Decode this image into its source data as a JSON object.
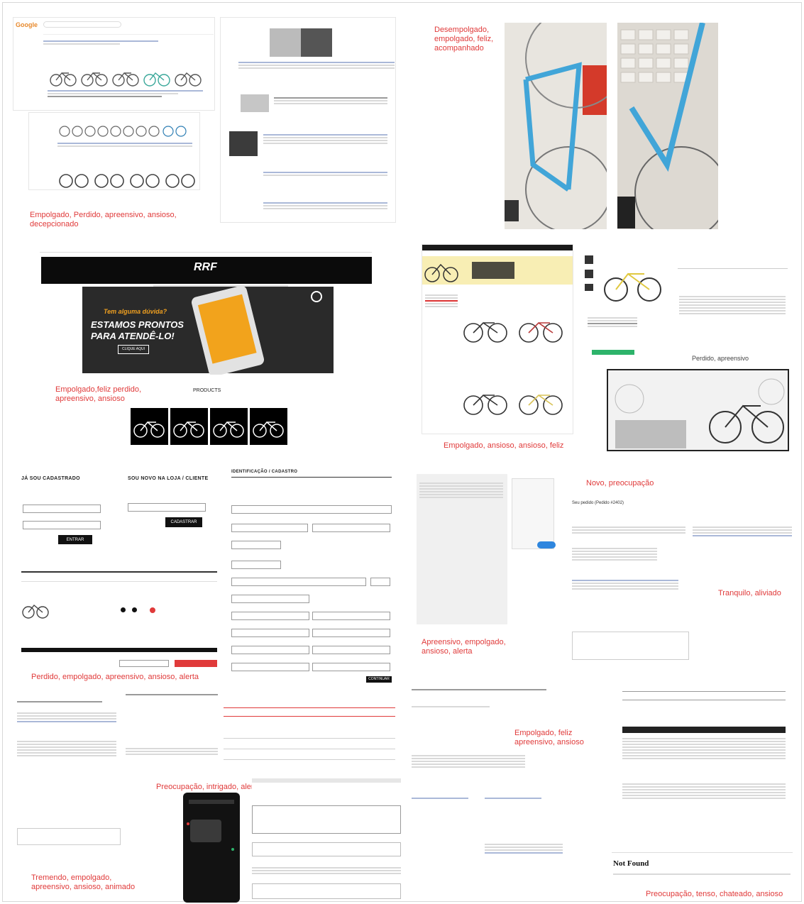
{
  "captions": {
    "c1": "Empolgado, Perdido, apreensivo, ansioso, decepcionado",
    "c2": "Desempolgado,\nempolgado, feliz,\nacompanhado",
    "c3": "Empolgado,feliz perdido,\napreensivo, ansioso",
    "c4": "Empolgado, ansioso, ansioso, feliz",
    "c5": "Perdido, apreensivo",
    "c6": "Perdido, empolgado, apreensivo, ansioso, alerta",
    "c7": "Apreensivo, empolgado,\nansioso, alerta",
    "c8": "Novo, preocupação",
    "c9": "Tranquilo, aliviado",
    "c10": "Preocupação, intrigado, alerta",
    "c11": "Empolgado, feliz\napreensivo, ansioso",
    "c12": "Preocupação, tenso, chateado, ansioso",
    "c13": "Tremendo, empolgado,\napreensivo, ansioso, animado"
  },
  "support": {
    "hero_line1": "Tem alguma dúvida?",
    "hero_line2": "ESTAMOS PRONTOS",
    "hero_line3": "PARA ATENDÊ-LO!",
    "hero_btn": "CLIQUE AQUI",
    "logo": "RRF",
    "products_label": "PRODUCTS"
  },
  "search": {
    "logo": "Google"
  },
  "login": {
    "existing_title": "JÁ SOU CADASTRADO",
    "new_title": "SOU NOVO NA LOJA / CLIENTE",
    "btn_enter": "ENTRAR",
    "btn_register": "CADASTRAR"
  },
  "checkout": {
    "page_title": "IDENTIFICAÇÃO / CADASTRO",
    "btn_continue": "CONTINUAR"
  },
  "order": {
    "title": "Seu pedido (Pedido #2402)"
  },
  "notfound": {
    "title": "Not Found"
  },
  "colors": {
    "caption": "#e03a3a",
    "accent": "#2e86de",
    "frame": "#41a5d8"
  }
}
